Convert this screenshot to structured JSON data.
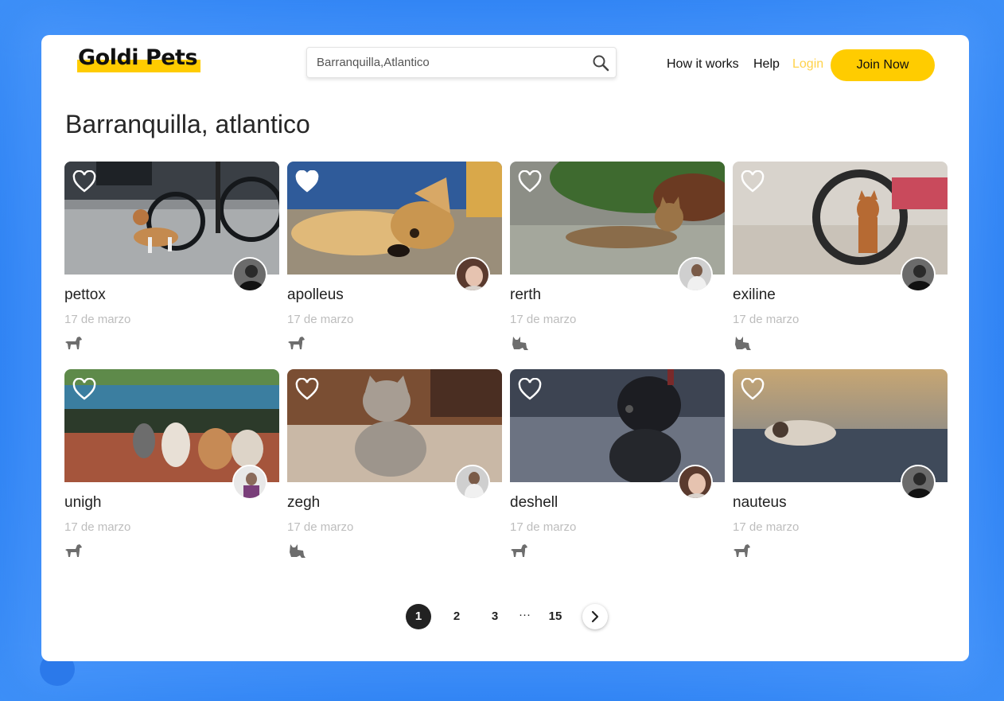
{
  "brand": {
    "name": "Goldi Pets",
    "accent": "#ffcc00"
  },
  "search": {
    "value": "Barranquilla,Atlantico",
    "icon": "search-icon"
  },
  "nav": {
    "how_it_works": "How it works",
    "help": "Help",
    "login": "Login",
    "join": "Join Now"
  },
  "page_title": "Barranquilla, atlantico",
  "pets": [
    {
      "name": "pettox",
      "date": "17 de marzo",
      "type": "dog",
      "favorited": false
    },
    {
      "name": "apolleus",
      "date": "17 de marzo",
      "type": "dog",
      "favorited": true
    },
    {
      "name": "rerth",
      "date": "17 de marzo",
      "type": "cat",
      "favorited": false
    },
    {
      "name": "exiline",
      "date": "17 de marzo",
      "type": "cat",
      "favorited": false
    },
    {
      "name": "unigh",
      "date": "17 de marzo",
      "type": "dog",
      "favorited": false
    },
    {
      "name": "zegh",
      "date": "17 de marzo",
      "type": "cat",
      "favorited": false
    },
    {
      "name": "deshell",
      "date": "17 de marzo",
      "type": "dog",
      "favorited": false
    },
    {
      "name": "nauteus",
      "date": "17 de marzo",
      "type": "dog",
      "favorited": false
    }
  ],
  "pagination": {
    "pages": [
      "1",
      "2",
      "3",
      "15"
    ],
    "current": "1",
    "ellipsis": "···"
  }
}
